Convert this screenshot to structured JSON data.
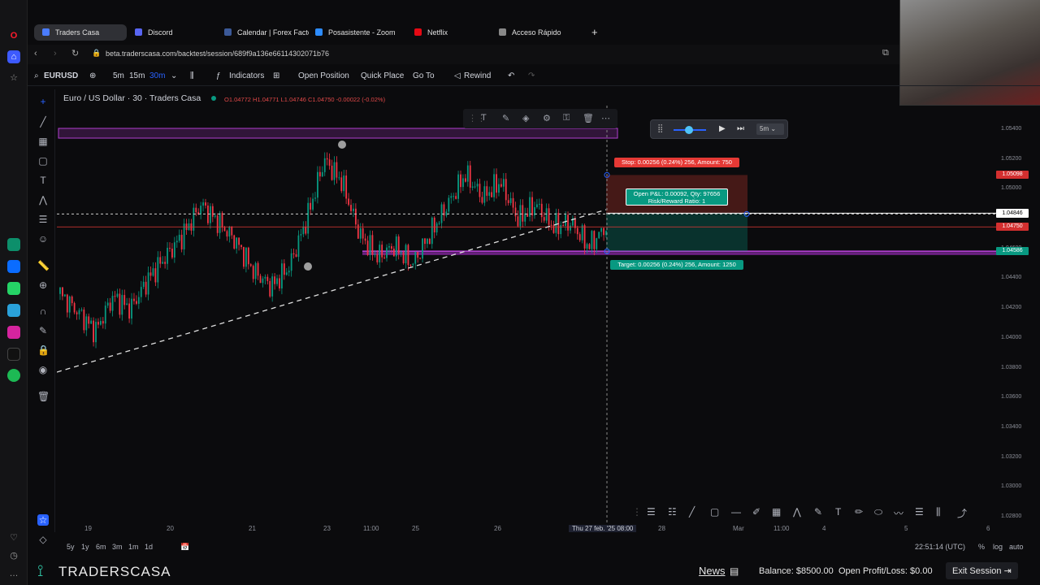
{
  "browser": {
    "tabs": [
      {
        "label": "Traders Casa",
        "color": "#4a7cff"
      },
      {
        "label": "Discord",
        "color": "#5865f2"
      },
      {
        "label": "Calendar | Forex Factory",
        "color": "#3b5998"
      },
      {
        "label": "Posasistente - Zoom",
        "color": "#2d8cff"
      },
      {
        "label": "Netflix",
        "color": "#e50914"
      },
      {
        "label": "Acceso Rápido",
        "color": "#888888"
      }
    ],
    "url": "beta.traderscasa.com/backtest/session/689f9a136e66114302071b76"
  },
  "toolbar": {
    "symbol": "EURUSD",
    "timeframes": [
      "5m",
      "15m",
      "30m"
    ],
    "active_timeframe": "30m",
    "indicators_label": "Indicators",
    "open_position_label": "Open Position",
    "quick_place_label": "Quick Place",
    "go_to_label": "Go To",
    "rewind_label": "Rewind"
  },
  "legend": {
    "title": "Euro / US Dollar · 30 · Traders Casa",
    "ohlc": "O1.04772 H1.04771 L1.04746 C1.04750 -0.00022 (-0.02%)"
  },
  "replay": {
    "speed": "5m"
  },
  "price_axis": {
    "labels": [
      "1.05400",
      "1.05200",
      "1.05000",
      "1.04600",
      "1.04400",
      "1.04200",
      "1.04000",
      "1.03800",
      "1.03600",
      "1.03400",
      "1.03200",
      "1.03000",
      "1.02800"
    ],
    "badges": [
      {
        "text": "1.05098",
        "color": "#d32f2f"
      },
      {
        "text": "1.04842",
        "color": "#ffffff"
      },
      {
        "text": "1.04846",
        "color": "#ffffff"
      },
      {
        "text": "1.04750",
        "color": "#d32f2f"
      },
      {
        "text": "1.04586",
        "color": "#089981"
      }
    ]
  },
  "time_axis": {
    "labels": [
      "19",
      "20",
      "21",
      "23",
      "11:00",
      "25",
      "26",
      "28",
      "Mar",
      "11:00",
      "4",
      "5",
      "6"
    ],
    "cursor_label": "Thu 27 feb. '25  08:00"
  },
  "position": {
    "stop": "Stop: 0.00256 (0.24%) 256, Amount: 750",
    "pnl_line1": "Open P&L: 0.00092, Qty: 97656",
    "pnl_line2": "Risk/Reward Ratio: 1",
    "target": "Target: 0.00256 (0.24%) 256, Amount: 1250"
  },
  "bottom": {
    "ranges": [
      "5y",
      "1y",
      "6m",
      "3m",
      "1m",
      "1d"
    ],
    "time": "22:51:14 (UTC)",
    "pct": "%",
    "log": "log",
    "auto": "auto"
  },
  "footer": {
    "brand": "TRADERSCASA",
    "news": "News",
    "balance": "Balance: $8500.00",
    "open_pl": "Open Profit/Loss: $0.00",
    "exit": "Exit Session"
  },
  "chart_data": {
    "type": "line",
    "series": [
      {
        "values": [
          1.043,
          1.0418,
          1.0405,
          1.0428,
          1.042,
          1.044,
          1.0455,
          1.047,
          1.049,
          1.0478,
          1.0465,
          1.0445,
          1.0435,
          1.0448,
          1.048,
          1.052,
          1.0505,
          1.047,
          1.0455,
          1.0462,
          1.045,
          1.047,
          1.049,
          1.051,
          1.0495,
          1.0505,
          1.048,
          1.049,
          1.0475,
          1.0478,
          1.0462,
          1.0475
        ]
      }
    ],
    "ylim": [
      1.028,
      1.055
    ],
    "stop": 1.05098,
    "entry": 1.04842,
    "target": 1.04586
  }
}
